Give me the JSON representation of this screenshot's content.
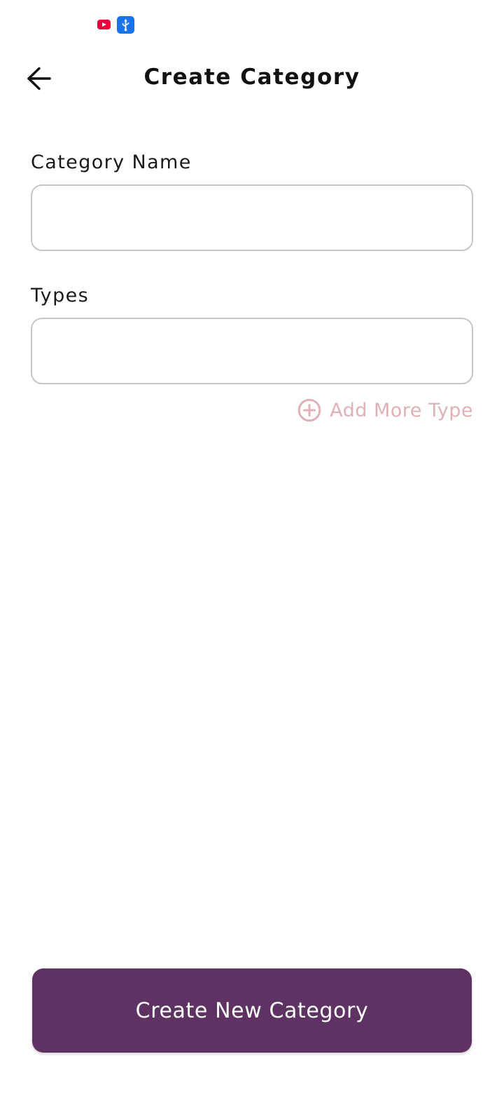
{
  "status_bar": {
    "icons": [
      "youtube-icon",
      "usb-icon"
    ]
  },
  "header": {
    "back_icon": "arrow-left-icon",
    "title": "Create Category"
  },
  "form": {
    "category_name": {
      "label": "Category Name",
      "value": "",
      "placeholder": ""
    },
    "types": {
      "label": "Types",
      "value": "",
      "placeholder": ""
    },
    "add_more": {
      "icon": "plus-circle-icon",
      "label": "Add More Type"
    }
  },
  "footer": {
    "create_button_label": "Create New Category"
  },
  "colors": {
    "primary": "#5e3262",
    "add_more_accent": "#dfb1b7",
    "field_border": "#c6c6c6",
    "youtube_red": "#e8003a",
    "usb_blue": "#1a73e8"
  }
}
